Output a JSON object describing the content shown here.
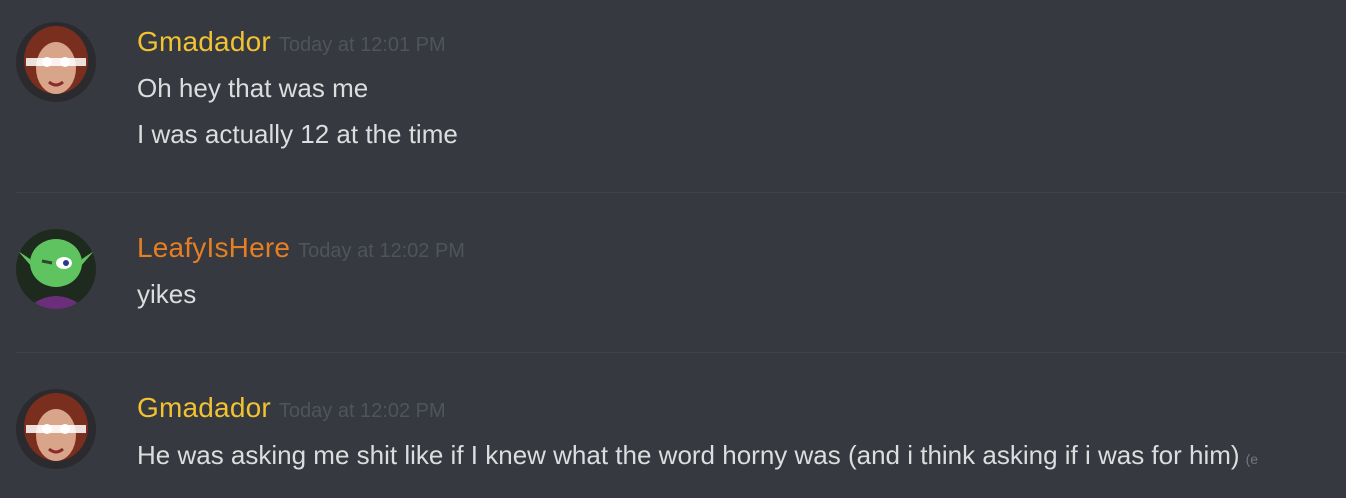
{
  "colors": {
    "background": "#36393f",
    "gmadador_name": "#f1c232",
    "leafy_name": "#e67e22",
    "message_text": "#dcddde",
    "timestamp": "#4f545c"
  },
  "messages": [
    {
      "author": "Gmadador",
      "timestamp": "Today at 12:01 PM",
      "avatar_icon": "glowing-eyes-woman-avatar",
      "lines": [
        "Oh hey that was me",
        "I was actually 12 at the time"
      ]
    },
    {
      "author": "LeafyIsHere",
      "timestamp": "Today at 12:02 PM",
      "avatar_icon": "green-goblin-avatar",
      "lines": [
        "yikes"
      ]
    },
    {
      "author": "Gmadador",
      "timestamp": "Today at 12:02 PM",
      "avatar_icon": "glowing-eyes-woman-avatar",
      "lines": [
        "He was asking me shit like if I knew what the word horny was (and i think asking if i was for him)"
      ],
      "trailing": "(e"
    }
  ]
}
